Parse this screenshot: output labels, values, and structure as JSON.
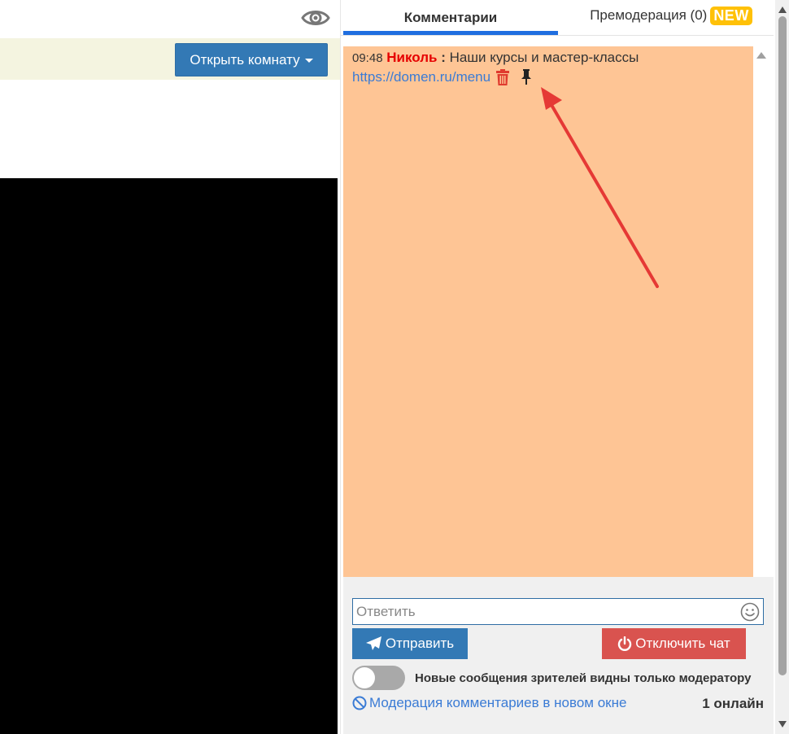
{
  "header": {
    "open_room_label": "Открыть комнату"
  },
  "tabs": {
    "comments_label": "Комментарии",
    "premoderation_label": "Премодерация (0)",
    "new_badge": "NEW"
  },
  "chat": {
    "message": {
      "time": "09:48",
      "author": "Николь",
      "separator": ":",
      "text": "Наши курсы и мастер-классы",
      "link": "https://domen.ru/menu"
    }
  },
  "composer": {
    "reply_placeholder": "Ответить",
    "send_label": "Отправить",
    "disable_chat_label": "Отключить чат",
    "toggle_label": "Новые сообщения зрителей видны только модератору",
    "moderation_link": "Модерация комментариев в новом окне",
    "online_count": "1 онлайн"
  },
  "colors": {
    "primary": "#3379b5",
    "danger": "#d9534f",
    "chat_background": "#fec595",
    "author": "#e60000",
    "annotation_arrow": "#e53935",
    "tab_active_indicator": "#1f6ee0",
    "badge": "#ffc107"
  }
}
